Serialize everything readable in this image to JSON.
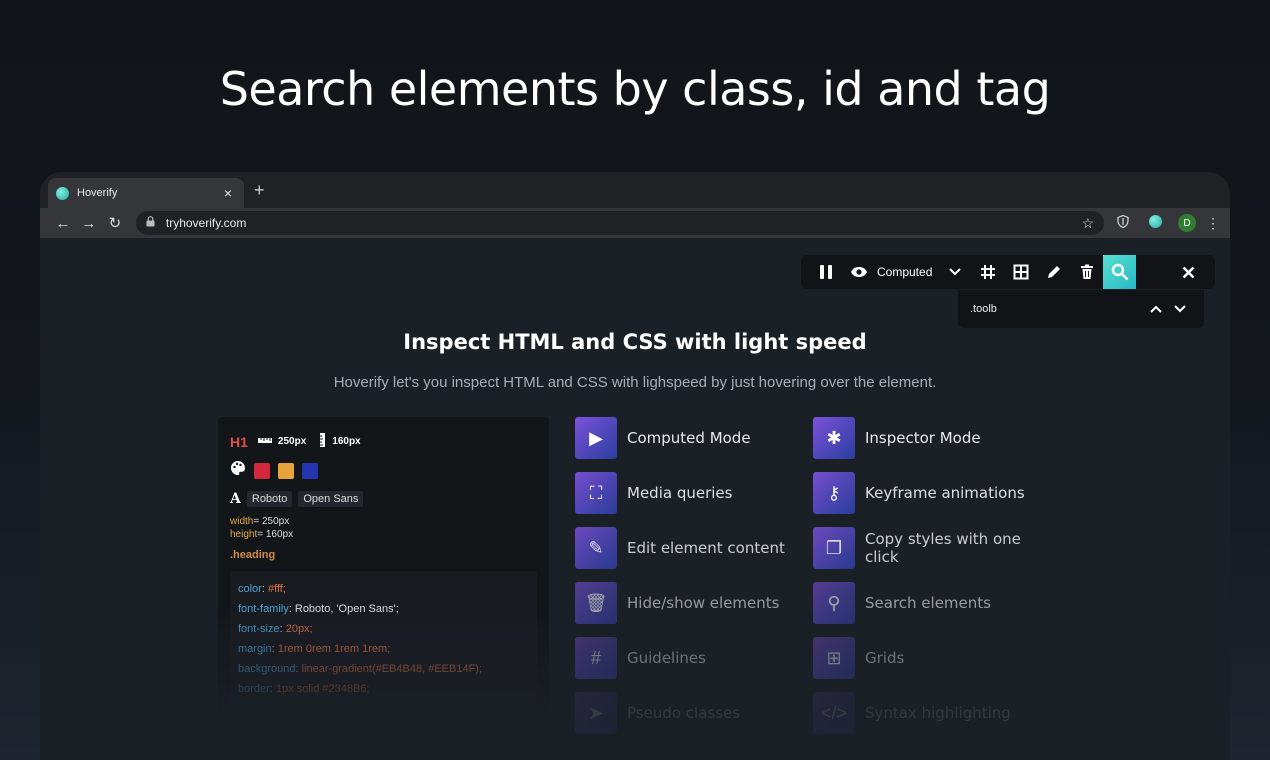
{
  "hero": {
    "title": "Search elements by class, id and tag"
  },
  "browser": {
    "tab": {
      "title": "Hoverify",
      "close": "×",
      "new_tab": "+",
      "favicon": "hoverify-favicon-icon"
    },
    "nav": {
      "back": "←",
      "forward": "→",
      "reload": "↻",
      "url": "tryhoverify.com",
      "star": "☆",
      "profile_initial": "D",
      "menu": "⋮"
    }
  },
  "toolbar": {
    "mode_label": "Computed",
    "icons": [
      "pause-icon",
      "eye-icon",
      "chevron-down-icon",
      "grid-lines-icon",
      "grid-icon",
      "pencil-icon",
      "trash-icon",
      "search-icon",
      "close-icon"
    ],
    "search_value": ".toolb",
    "accent": "#3cc9c8"
  },
  "page": {
    "heading": "Inspect HTML and CSS with light speed",
    "subheading": "Hoverify let's you inspect HTML and CSS with lighspeed by just hovering over the element."
  },
  "card": {
    "tag": "H1",
    "width_badge": "250px",
    "height_badge": "160px",
    "colors": [
      "#d2283c",
      "#e8a23c",
      "#2336b0"
    ],
    "fonts": [
      "Roboto",
      "Open Sans"
    ],
    "font_icon": "A",
    "width_key": "width",
    "width_val": "= 250px",
    "height_key": "height",
    "height_val": "= 160px",
    "class_name": ".heading",
    "css": [
      {
        "prop": "color",
        "value": "#fff;"
      },
      {
        "prop": "font-family",
        "value": "Roboto, 'Open Sans';"
      },
      {
        "prop": "font-size",
        "value": "20px;"
      },
      {
        "prop": "margin",
        "value": "1rem 0rem 1rem 1rem;"
      },
      {
        "prop": "background",
        "value": "linear-gradient(#EB4B48, #EEB14F);"
      },
      {
        "prop": "border",
        "value": "1px solid #2348B6;"
      }
    ]
  },
  "features": [
    {
      "label": "Computed Mode",
      "icon": "play-icon",
      "glyph": "▶"
    },
    {
      "label": "Inspector Mode",
      "icon": "bug-icon",
      "glyph": "✱"
    },
    {
      "label": "Media queries",
      "icon": "fullscreen-icon",
      "glyph": "⛶"
    },
    {
      "label": "Keyframe animations",
      "icon": "key-icon",
      "glyph": "⚷"
    },
    {
      "label": "Edit element content",
      "icon": "pencil-icon",
      "glyph": "✎"
    },
    {
      "label": "Copy styles with one click",
      "icon": "copy-icon",
      "glyph": "❐"
    },
    {
      "label": "Hide/show elements",
      "icon": "trash-icon",
      "glyph": "🗑"
    },
    {
      "label": "Search elements",
      "icon": "search-icon",
      "glyph": "⚲"
    },
    {
      "label": "Guidelines",
      "icon": "grid-lines-icon",
      "glyph": "#"
    },
    {
      "label": "Grids",
      "icon": "grid-icon",
      "glyph": "⊞"
    },
    {
      "label": "Pseudo classes",
      "icon": "cursor-icon",
      "glyph": "➤"
    },
    {
      "label": "Syntax highlighting",
      "icon": "code-icon",
      "glyph": "</>"
    }
  ]
}
